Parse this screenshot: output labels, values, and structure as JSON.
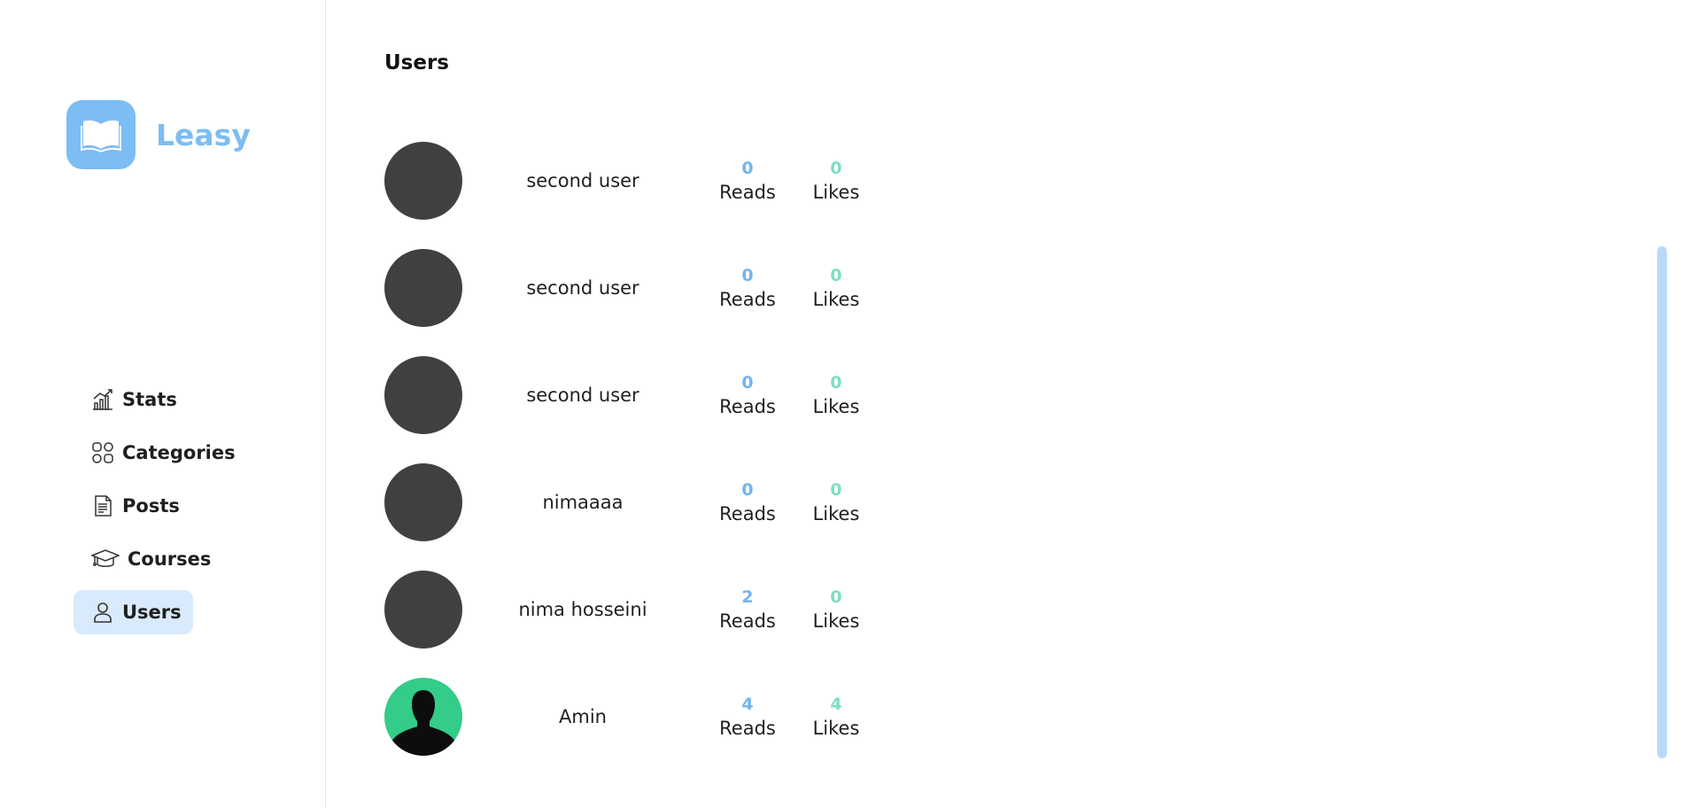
{
  "brand": {
    "name": "Leasy",
    "color": "#7cbdf3"
  },
  "nav": {
    "items": [
      {
        "label": "Stats",
        "icon": "chart-icon",
        "active": false
      },
      {
        "label": "Categories",
        "icon": "grid-icon",
        "active": false
      },
      {
        "label": "Posts",
        "icon": "document-icon",
        "active": false
      },
      {
        "label": "Courses",
        "icon": "graduation-cap-icon",
        "active": false
      },
      {
        "label": "Users",
        "icon": "user-icon",
        "active": true
      }
    ]
  },
  "main": {
    "title": "Users",
    "reads_label": "Reads",
    "likes_label": "Likes",
    "users": [
      {
        "name": "second user",
        "reads": "0",
        "likes": "0",
        "avatar": "placeholder"
      },
      {
        "name": "second user",
        "reads": "0",
        "likes": "0",
        "avatar": "placeholder"
      },
      {
        "name": "second user",
        "reads": "0",
        "likes": "0",
        "avatar": "placeholder"
      },
      {
        "name": "nimaaaa",
        "reads": "0",
        "likes": "0",
        "avatar": "placeholder"
      },
      {
        "name": "nima hosseini",
        "reads": "2",
        "likes": "0",
        "avatar": "placeholder"
      },
      {
        "name": "Amin",
        "reads": "4",
        "likes": "4",
        "avatar": "silhouette-photo"
      }
    ]
  },
  "colors": {
    "accent": "#7cbdf3",
    "reads": "#71b5f0",
    "likes": "#7be0bb",
    "active_nav_bg": "#d8eafb",
    "avatar_placeholder": "#404040",
    "avatar_photo_bg": "#33cc88"
  }
}
